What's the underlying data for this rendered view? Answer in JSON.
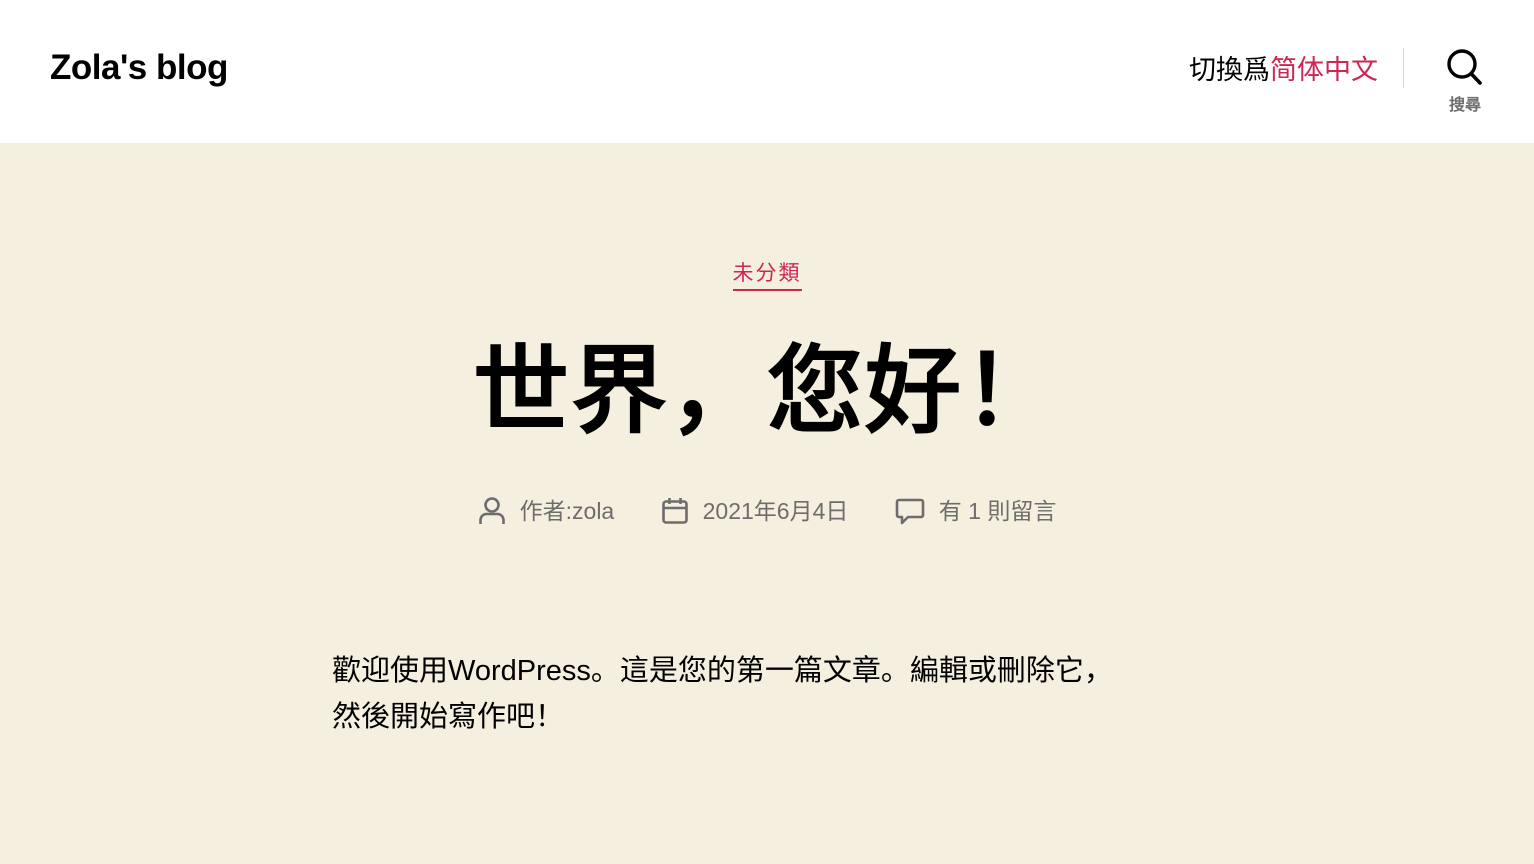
{
  "header": {
    "site_title": "Zola's blog",
    "lang_prefix": "切換爲",
    "lang_link": "简体中文",
    "search_label": "搜尋"
  },
  "post": {
    "category": "未分類",
    "title": "世界，您好！",
    "meta": {
      "author_prefix": "作者: ",
      "author": "zola",
      "date": "2021年6月4日",
      "comments": "有 1 則留言"
    },
    "content_line1": "歡迎使用WordPress。這是您的第一篇文章。編輯或刪除它，",
    "content_line2": "然後開始寫作吧！"
  },
  "colors": {
    "accent": "#cd2653",
    "background": "#f5efe0",
    "header_background": "#ffffff",
    "meta_text": "#6d6d6d"
  },
  "icons": {
    "search": "search-icon",
    "author": "user-icon",
    "date": "calendar-icon",
    "comments": "comment-icon"
  }
}
